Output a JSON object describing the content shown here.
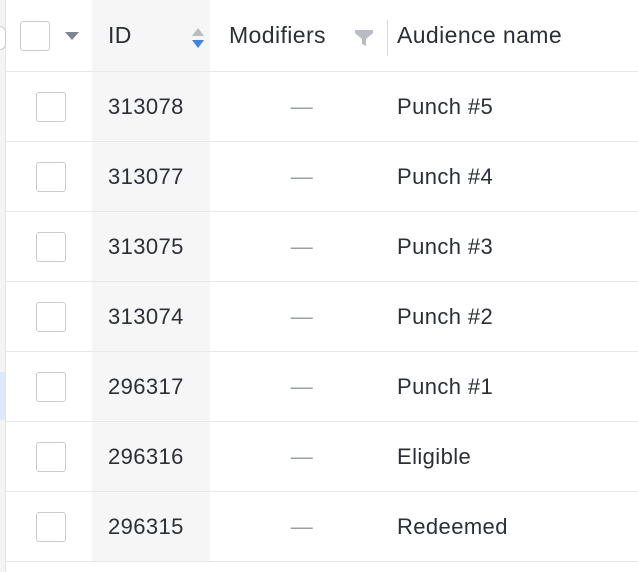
{
  "table": {
    "columns": {
      "id": "ID",
      "modifiers": "Modifiers",
      "audience_name": "Audience name"
    },
    "sort": {
      "column": "ID",
      "direction": "descending"
    },
    "rows": [
      {
        "id": "313078",
        "modifiers": "—",
        "audience_name": "Punch #5"
      },
      {
        "id": "313077",
        "modifiers": "—",
        "audience_name": "Punch #4"
      },
      {
        "id": "313075",
        "modifiers": "—",
        "audience_name": "Punch #3"
      },
      {
        "id": "313074",
        "modifiers": "—",
        "audience_name": "Punch #2"
      },
      {
        "id": "296317",
        "modifiers": "—",
        "audience_name": "Punch #1"
      },
      {
        "id": "296316",
        "modifiers": "—",
        "audience_name": "Eligible"
      },
      {
        "id": "296315",
        "modifiers": "—",
        "audience_name": "Redeemed"
      }
    ]
  },
  "icons": {
    "select_menu": "caret-down-icon",
    "sort": "sort-icon",
    "filter": "filter-icon"
  },
  "colors": {
    "sort_active": "#3b82f6",
    "sort_inactive": "#b8bcc3",
    "filter": "#b8bcc3",
    "id_column_bg": "#f6f6f7"
  }
}
